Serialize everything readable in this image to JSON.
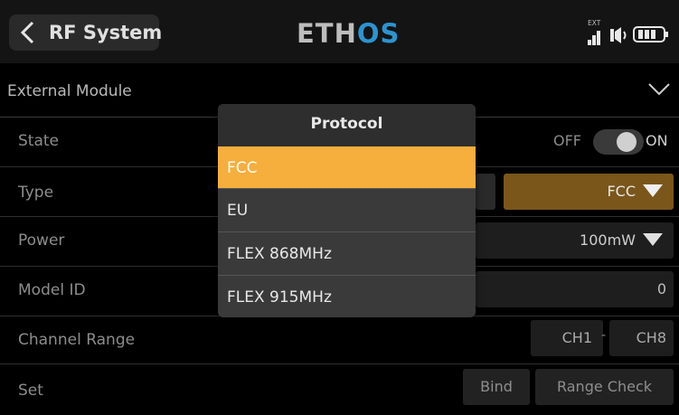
{
  "header": {
    "title": "RF System",
    "logo_main": "ETH",
    "logo_accent": "OS",
    "ext_label": "EXT"
  },
  "section": {
    "label": "External Module"
  },
  "rows": {
    "state": {
      "label": "State",
      "off_label": "OFF",
      "on_label": "ON"
    },
    "type": {
      "label": "Type",
      "value": "FCC"
    },
    "power": {
      "label": "Power",
      "value": "100mW"
    },
    "model_id": {
      "label": "Model ID",
      "value": "0"
    },
    "channel_range": {
      "label": "Channel Range",
      "start": "CH1",
      "separator": "-",
      "end": "CH8"
    },
    "set": {
      "label": "Set",
      "bind": "Bind",
      "range_check": "Range Check"
    }
  },
  "modal": {
    "title": "Protocol",
    "options": [
      {
        "label": "FCC",
        "selected": true
      },
      {
        "label": "EU",
        "selected": false
      },
      {
        "label": "FLEX 868MHz",
        "selected": false
      },
      {
        "label": "FLEX 915MHz",
        "selected": false
      }
    ]
  },
  "colors": {
    "accent": "#f6ae3d",
    "logo_accent": "#2c94cf",
    "type_field": "#7a561b"
  }
}
